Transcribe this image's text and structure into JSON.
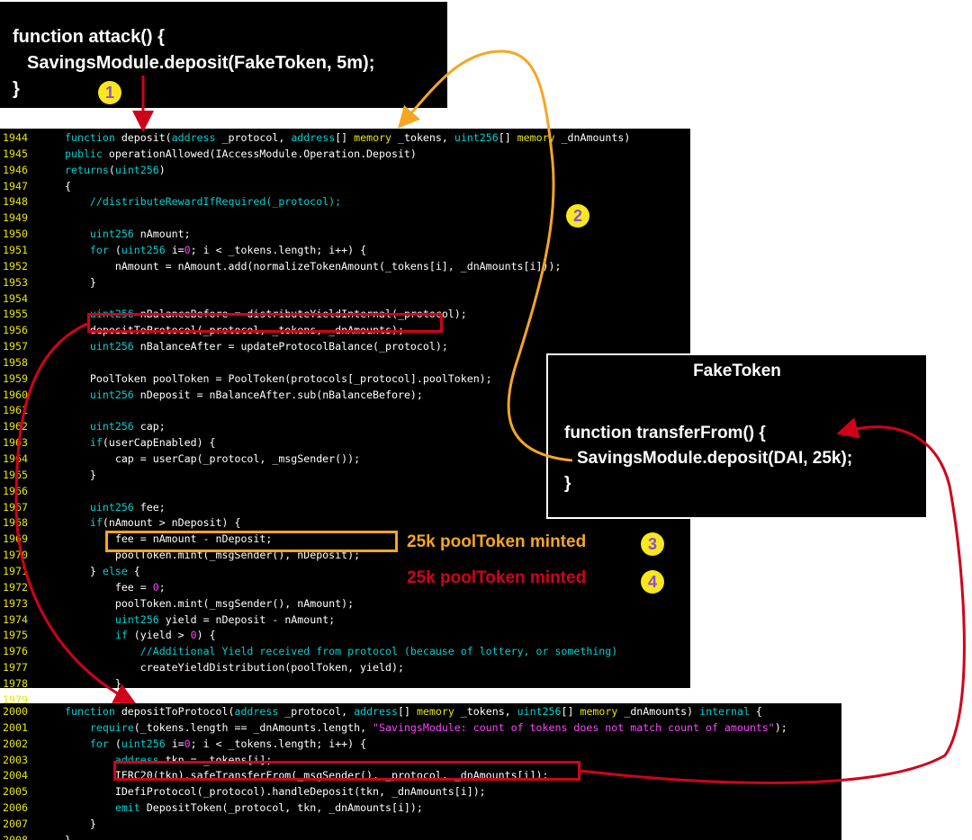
{
  "attack": {
    "line1": "function attack() {",
    "line2": "SavingsModule.deposit(FakeToken, 5m);",
    "line3": "}"
  },
  "fake_token": {
    "title": "FakeToken",
    "line1": "function transferFrom() {",
    "line2": "SavingsModule.deposit(DAI, 25k);",
    "line3": "}"
  },
  "annotations": {
    "badge1": "1",
    "badge2": "2",
    "badge3": "3",
    "badge4": "4",
    "minted3": "25k poolToken minted",
    "minted4": "25k poolToken minted"
  },
  "colors": {
    "orange": "#f5a623",
    "red": "#d0021b",
    "badge": "#f8e71c",
    "line_number": "#e8e800",
    "keyword": "#00d0d0"
  },
  "code_top": [
    {
      "n": "1944",
      "t": "function deposit(address _protocol, address[] memory _tokens, uint256[] memory _dnAmounts)"
    },
    {
      "n": "1945",
      "t": "public operationAllowed(IAccessModule.Operation.Deposit)"
    },
    {
      "n": "1946",
      "t": "returns(uint256)"
    },
    {
      "n": "1947",
      "t": "{"
    },
    {
      "n": "1948",
      "t": "    //distributeRewardIfRequired(_protocol);"
    },
    {
      "n": "1949",
      "t": ""
    },
    {
      "n": "1950",
      "t": "    uint256 nAmount;"
    },
    {
      "n": "1951",
      "t": "    for (uint256 i=0; i < _tokens.length; i++) {"
    },
    {
      "n": "1952",
      "t": "        nAmount = nAmount.add(normalizeTokenAmount(_tokens[i], _dnAmounts[i]));"
    },
    {
      "n": "1953",
      "t": "    }"
    },
    {
      "n": "1954",
      "t": ""
    },
    {
      "n": "1955",
      "t": "    uint256 nBalanceBefore = distributeYieldInternal(_protocol);"
    },
    {
      "n": "1956",
      "t": "    depositToProtocol(_protocol, _tokens, _dnAmounts);"
    },
    {
      "n": "1957",
      "t": "    uint256 nBalanceAfter = updateProtocolBalance(_protocol);"
    },
    {
      "n": "1958",
      "t": ""
    },
    {
      "n": "1959",
      "t": "    PoolToken poolToken = PoolToken(protocols[_protocol].poolToken);"
    },
    {
      "n": "1960",
      "t": "    uint256 nDeposit = nBalanceAfter.sub(nBalanceBefore);"
    },
    {
      "n": "1961",
      "t": ""
    },
    {
      "n": "1962",
      "t": "    uint256 cap;"
    },
    {
      "n": "1963",
      "t": "    if(userCapEnabled) {"
    },
    {
      "n": "1964",
      "t": "        cap = userCap(_protocol, _msgSender());"
    },
    {
      "n": "1965",
      "t": "    }"
    },
    {
      "n": "1966",
      "t": ""
    },
    {
      "n": "1967",
      "t": "    uint256 fee;"
    },
    {
      "n": "1968",
      "t": "    if(nAmount > nDeposit) {"
    },
    {
      "n": "1969",
      "t": "        fee = nAmount - nDeposit;"
    },
    {
      "n": "1970",
      "t": "        poolToken.mint(_msgSender(), nDeposit);"
    },
    {
      "n": "1971",
      "t": "    } else {"
    },
    {
      "n": "1972",
      "t": "        fee = 0;"
    },
    {
      "n": "1973",
      "t": "        poolToken.mint(_msgSender(), nAmount);"
    },
    {
      "n": "1974",
      "t": "        uint256 yield = nDeposit - nAmount;"
    },
    {
      "n": "1975",
      "t": "        if (yield > 0) {"
    },
    {
      "n": "1976",
      "t": "            //Additional Yield received from protocol (because of lottery, or something)"
    },
    {
      "n": "1977",
      "t": "            createYieldDistribution(poolToken, yield);"
    },
    {
      "n": "1978",
      "t": "        }"
    },
    {
      "n": "1979",
      "t": "    }"
    }
  ],
  "code_bottom": [
    {
      "n": "2000",
      "t": "function depositToProtocol(address _protocol, address[] memory _tokens, uint256[] memory _dnAmounts) internal {"
    },
    {
      "n": "2001",
      "t": "    require(_tokens.length == _dnAmounts.length, \"SavingsModule: count of tokens does not match count of amounts\");"
    },
    {
      "n": "2002",
      "t": "    for (uint256 i=0; i < _tokens.length; i++) {"
    },
    {
      "n": "2003",
      "t": "        address tkn = _tokens[i];"
    },
    {
      "n": "2004",
      "t": "        IERC20(tkn).safeTransferFrom(_msgSender(), _protocol, _dnAmounts[i]);"
    },
    {
      "n": "2005",
      "t": "        IDefiProtocol(_protocol).handleDeposit(tkn, _dnAmounts[i]);"
    },
    {
      "n": "2006",
      "t": "        emit DepositToken(_protocol, tkn, _dnAmounts[i]);"
    },
    {
      "n": "2007",
      "t": "    }"
    },
    {
      "n": "2008",
      "t": "}"
    }
  ]
}
